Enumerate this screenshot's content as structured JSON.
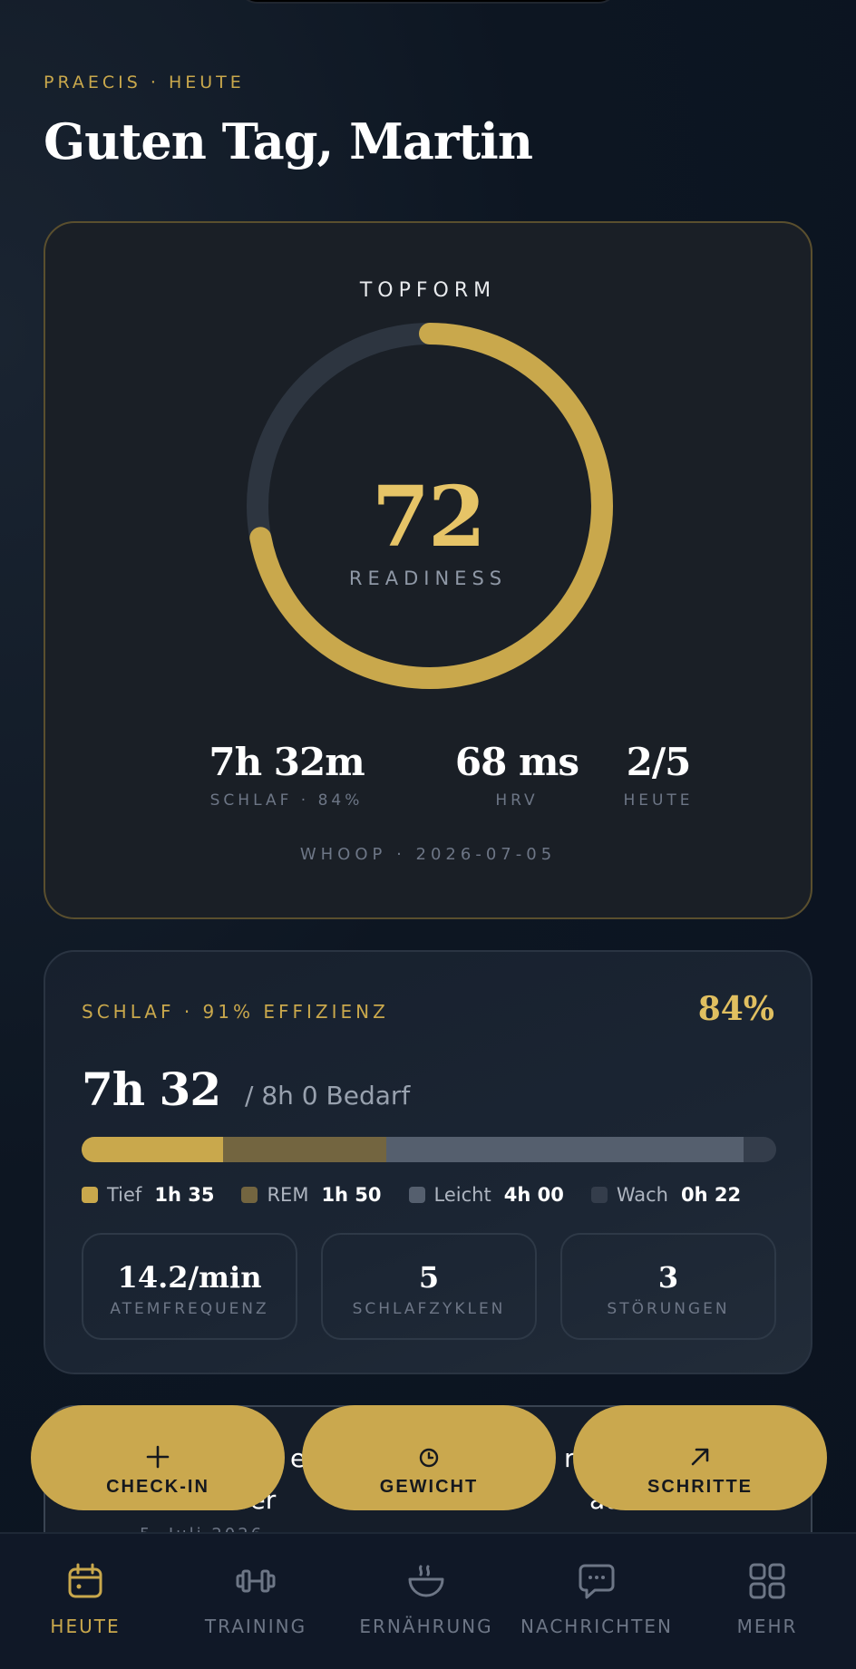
{
  "header": {
    "eyebrow": "PRAECIS · HEUTE",
    "greeting": "Guten Tag, Martin"
  },
  "readiness": {
    "title": "TOPFORM",
    "score": "72",
    "score_value": 72,
    "score_label": "READINESS",
    "accent_color": "#c9a84c",
    "stats": [
      {
        "value": "7h 32m",
        "label": "SCHLAF · 84%"
      },
      {
        "value": "68 ms",
        "label": "HRV"
      },
      {
        "value": "2/5",
        "label": "HEUTE"
      }
    ],
    "source": "WHOOP · 2026-07-05"
  },
  "sleep": {
    "eyebrow": "SCHLAF · 91% EFFIZIENZ",
    "percent": "84%",
    "duration": "7h 32",
    "need": "/ 8h 0 Bedarf",
    "stages": [
      {
        "name": "Tief",
        "value": "1h 35",
        "minutes": 95,
        "color": "#c9a84c"
      },
      {
        "name": "REM",
        "value": "1h 50",
        "minutes": 110,
        "color": "#736540"
      },
      {
        "name": "Leicht",
        "value": "4h 00",
        "minutes": 240,
        "color": "#555f6e"
      },
      {
        "name": "Wach",
        "value": "0h 22",
        "minutes": 22,
        "color": "#343d4b"
      }
    ],
    "metrics": [
      {
        "value": "14.2/min",
        "label": "ATEMFREQUENZ"
      },
      {
        "value": "5",
        "label": "SCHLAFZYKLEN"
      },
      {
        "value": "3",
        "label": "STÖRUNGEN"
      }
    ]
  },
  "hidden_card": {
    "line1_fragments": [
      "er",
      "rt"
    ],
    "line2_fragments": [
      "uber",
      "au so"
    ],
    "date_fragment": "5. Juli 2026"
  },
  "actions": [
    {
      "label": "CHECK-IN",
      "icon": "plus-icon"
    },
    {
      "label": "GEWICHT",
      "icon": "clock-icon"
    },
    {
      "label": "SCHRITTE",
      "icon": "arrow-up-right-icon"
    }
  ],
  "nav": [
    {
      "label": "HEUTE",
      "icon": "calendar-icon",
      "active": true
    },
    {
      "label": "TRAINING",
      "icon": "dumbbell-icon",
      "active": false
    },
    {
      "label": "ERNÄHRUNG",
      "icon": "bowl-icon",
      "active": false
    },
    {
      "label": "NACHRICHTEN",
      "icon": "chat-icon",
      "active": false
    },
    {
      "label": "MEHR",
      "icon": "grid-icon",
      "active": false
    }
  ]
}
